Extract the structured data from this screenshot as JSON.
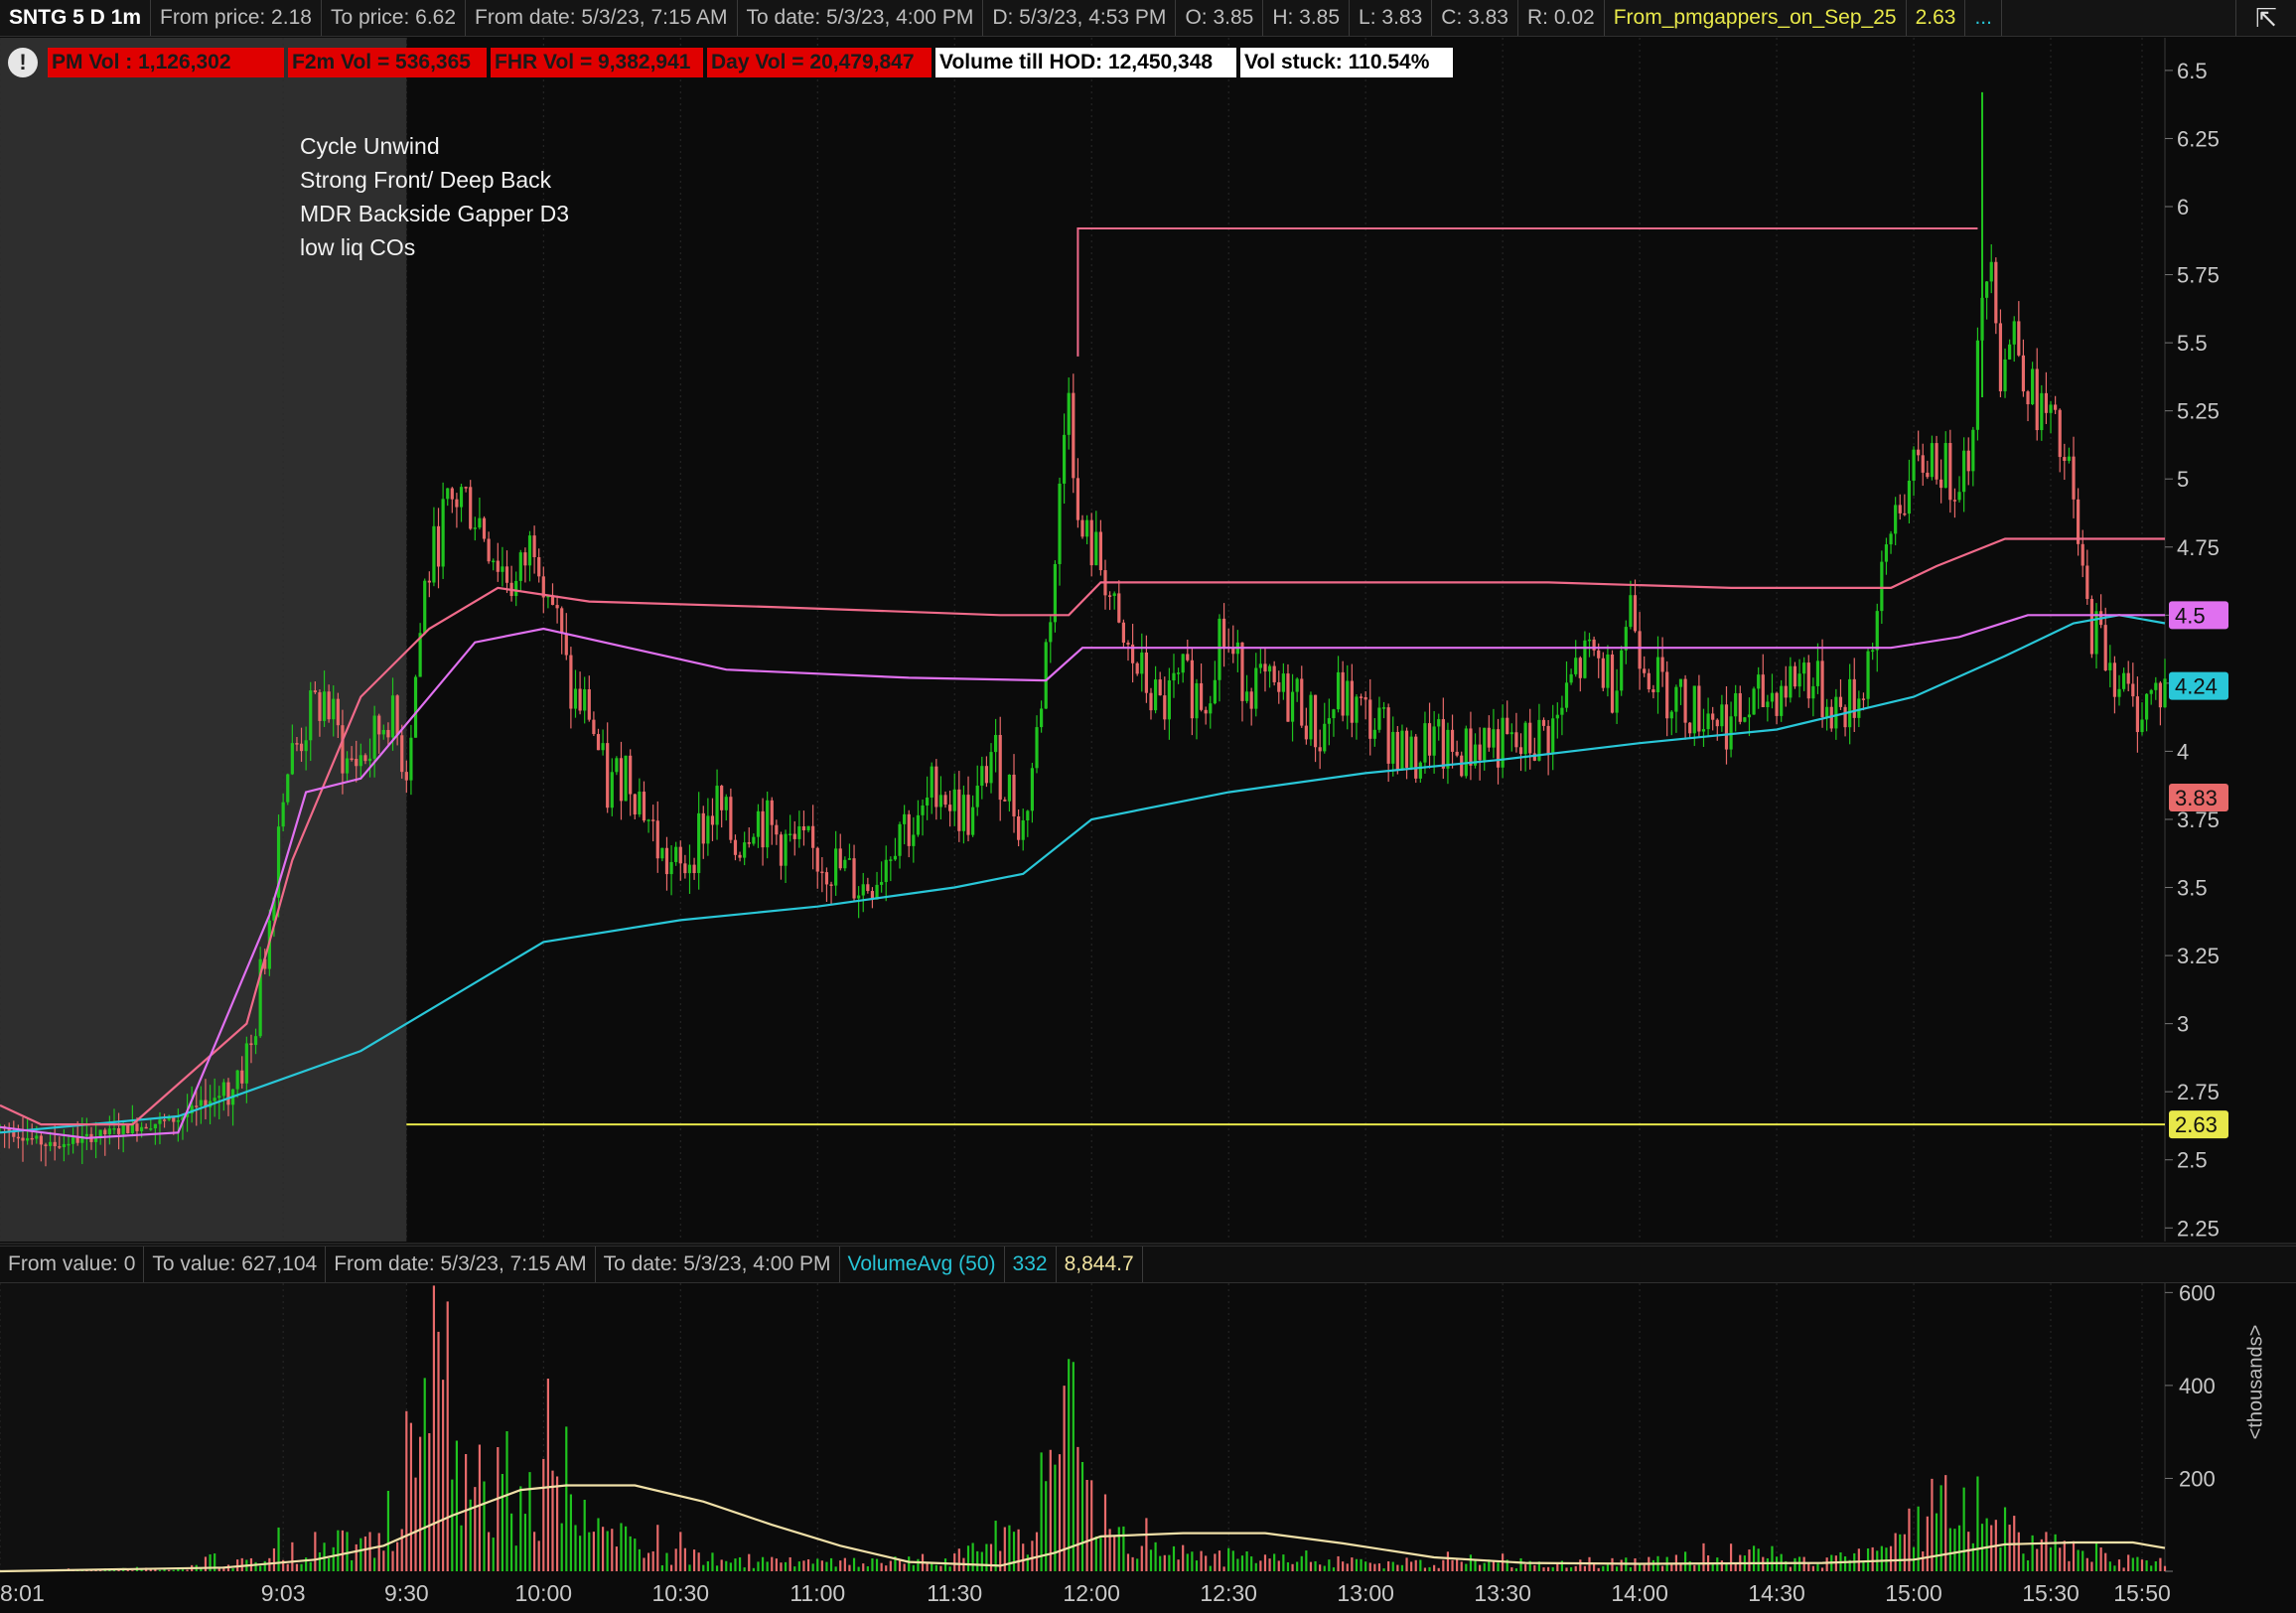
{
  "header": {
    "symbol": "SNTG 5 D 1m",
    "from_price": "From price: 2.18",
    "to_price": "To price: 6.62",
    "from_date": "From date: 5/3/23, 7:15 AM",
    "to_date": "To date: 5/3/23, 4:00 PM",
    "d": "D: 5/3/23, 4:53 PM",
    "o": "O: 3.85",
    "h": "H: 3.85",
    "l": "L: 3.83",
    "c": "C: 3.83",
    "r": "R: 0.02",
    "study_name": "From_pmgappers_on_Sep_25",
    "study_value": "2.63",
    "more": "...",
    "collapse_icon": "collapse-icon"
  },
  "stat_boxes": {
    "alert_icon": "!",
    "pm_vol": "PM Vol : 1,126,302",
    "f2m_vol": "F2m Vol = 536,365",
    "fhr_vol": "FHR Vol = 9,382,941",
    "day_vol": "Day Vol = 20,479,847",
    "vol_till_hod": "Volume till HOD: 12,450,348",
    "vol_stuck": "Vol stuck: 110.54%"
  },
  "notes": [
    "Cycle Unwind",
    "Strong Front/ Deep Back",
    "MDR Backside Gapper D3",
    "low liq COs"
  ],
  "volume_header": {
    "from_value": "From value: 0",
    "to_value": "To value: 627,104",
    "from_date": "From date: 5/3/23, 7:15 AM",
    "to_date": "To date: 5/3/23, 4:00 PM",
    "study": "VolumeAvg (50)",
    "v1": "332",
    "v2": "8,844.7"
  },
  "volume_unit_label": "<thousands>",
  "colors": {
    "up": "#1fc41f",
    "down": "#e86a6a",
    "vwap": "#29c7d8",
    "band_upper": "#f06a8a",
    "band_mid": "#e070f0",
    "level": "#e8e84a",
    "volavg": "#f0e0a8",
    "premarket_shade": "#2e2e2e"
  },
  "chart_data": [
    {
      "type": "candlestick",
      "title": "SNTG 5 D 1m",
      "y_range": [
        2.2,
        6.62
      ],
      "y_ticks": [
        2.25,
        2.5,
        2.75,
        3,
        3.25,
        3.5,
        3.75,
        4,
        4.25,
        4.5,
        4.75,
        5,
        5.25,
        5.5,
        5.75,
        6,
        6.25,
        6.5
      ],
      "y_tick_labels": [
        "2.25",
        "2.5",
        "2.75",
        "3",
        "3.25",
        "3.5",
        "3.75",
        "4",
        "4.25",
        "4.5",
        "4.75",
        "5",
        "5.25",
        "5.5",
        "5.75",
        "6",
        "6.25",
        "6.5"
      ],
      "x_range_min": [
        481,
        955
      ],
      "x_ticks_min": [
        481,
        543,
        570,
        600,
        630,
        660,
        690,
        720,
        750,
        780,
        810,
        840,
        870,
        900,
        930,
        950
      ],
      "x_tick_labels": [
        "8:01",
        "9:03",
        "9:30",
        "10:00",
        "10:30",
        "11:00",
        "11:30",
        "12:00",
        "12:30",
        "13:00",
        "13:30",
        "14:00",
        "14:30",
        "15:00",
        "15:30",
        "15:50"
      ],
      "premarket_end_min": 570,
      "price_path": [
        [
          481,
          2.62
        ],
        [
          492,
          2.55
        ],
        [
          500,
          2.58
        ],
        [
          510,
          2.62
        ],
        [
          520,
          2.65
        ],
        [
          530,
          2.75
        ],
        [
          536,
          2.9
        ],
        [
          540,
          3.4
        ],
        [
          543,
          3.9
        ],
        [
          548,
          4.1
        ],
        [
          552,
          4.2
        ],
        [
          557,
          3.95
        ],
        [
          562,
          4.0
        ],
        [
          566,
          4.15
        ],
        [
          570,
          3.95
        ],
        [
          574,
          4.6
        ],
        [
          578,
          4.85
        ],
        [
          582,
          4.95
        ],
        [
          586,
          4.85
        ],
        [
          590,
          4.7
        ],
        [
          594,
          4.6
        ],
        [
          598,
          4.8
        ],
        [
          602,
          4.55
        ],
        [
          606,
          4.2
        ],
        [
          610,
          4.15
        ],
        [
          614,
          3.85
        ],
        [
          618,
          3.95
        ],
        [
          622,
          3.8
        ],
        [
          626,
          3.6
        ],
        [
          630,
          3.55
        ],
        [
          634,
          3.7
        ],
        [
          638,
          3.8
        ],
        [
          642,
          3.65
        ],
        [
          646,
          3.78
        ],
        [
          650,
          3.7
        ],
        [
          654,
          3.65
        ],
        [
          658,
          3.62
        ],
        [
          662,
          3.6
        ],
        [
          666,
          3.55
        ],
        [
          670,
          3.5
        ],
        [
          674,
          3.58
        ],
        [
          678,
          3.75
        ],
        [
          682,
          3.7
        ],
        [
          686,
          3.9
        ],
        [
          690,
          3.8
        ],
        [
          694,
          3.75
        ],
        [
          698,
          4.0
        ],
        [
          702,
          3.85
        ],
        [
          705,
          3.72
        ],
        [
          708,
          4.05
        ],
        [
          712,
          4.7
        ],
        [
          715,
          5.4
        ],
        [
          717,
          4.8
        ],
        [
          720,
          4.75
        ],
        [
          723,
          4.65
        ],
        [
          726,
          4.4
        ],
        [
          730,
          4.3
        ],
        [
          735,
          4.15
        ],
        [
          740,
          4.25
        ],
        [
          745,
          4.2
        ],
        [
          748,
          4.45
        ],
        [
          752,
          4.3
        ],
        [
          756,
          4.25
        ],
        [
          760,
          4.2
        ],
        [
          765,
          4.2
        ],
        [
          770,
          4.05
        ],
        [
          774,
          4.2
        ],
        [
          778,
          4.15
        ],
        [
          782,
          4.1
        ],
        [
          786,
          4.05
        ],
        [
          790,
          3.95
        ],
        [
          794,
          4.05
        ],
        [
          798,
          3.98
        ],
        [
          802,
          4.0
        ],
        [
          806,
          4.05
        ],
        [
          810,
          4.02
        ],
        [
          814,
          4.0
        ],
        [
          818,
          4.05
        ],
        [
          822,
          4.1
        ],
        [
          826,
          4.3
        ],
        [
          830,
          4.35
        ],
        [
          834,
          4.25
        ],
        [
          838,
          4.55
        ],
        [
          840,
          4.4
        ],
        [
          844,
          4.25
        ],
        [
          848,
          4.2
        ],
        [
          852,
          4.15
        ],
        [
          856,
          4.15
        ],
        [
          860,
          4.1
        ],
        [
          864,
          4.15
        ],
        [
          868,
          4.2
        ],
        [
          872,
          4.25
        ],
        [
          876,
          4.3
        ],
        [
          880,
          4.2
        ],
        [
          884,
          4.15
        ],
        [
          888,
          4.2
        ],
        [
          892,
          4.5
        ],
        [
          896,
          4.9
        ],
        [
          900,
          5.0
        ],
        [
          904,
          5.1
        ],
        [
          908,
          5.0
        ],
        [
          912,
          5.1
        ],
        [
          915,
          5.6
        ],
        [
          917,
          5.9
        ],
        [
          919,
          5.4
        ],
        [
          922,
          5.55
        ],
        [
          926,
          5.3
        ],
        [
          930,
          5.2
        ],
        [
          934,
          5.0
        ],
        [
          938,
          4.5
        ],
        [
          941,
          4.4
        ],
        [
          944,
          4.3
        ],
        [
          948,
          4.15
        ],
        [
          952,
          4.2
        ],
        [
          955,
          4.24
        ]
      ],
      "series": [
        {
          "name": "VWAP",
          "values": [
            [
              481,
              2.6
            ],
            [
              520,
              2.66
            ],
            [
              560,
              2.9
            ],
            [
              600,
              3.3
            ],
            [
              630,
              3.38
            ],
            [
              660,
              3.43
            ],
            [
              690,
              3.5
            ],
            [
              705,
              3.55
            ],
            [
              720,
              3.75
            ],
            [
              750,
              3.85
            ],
            [
              780,
              3.92
            ],
            [
              810,
              3.97
            ],
            [
              840,
              4.03
            ],
            [
              870,
              4.08
            ],
            [
              900,
              4.2
            ],
            [
              920,
              4.35
            ],
            [
              935,
              4.47
            ],
            [
              945,
              4.5
            ],
            [
              955,
              4.47
            ]
          ]
        },
        {
          "name": "VWAP band upper",
          "values": [
            [
              481,
              2.7
            ],
            [
              490,
              2.63
            ],
            [
              510,
              2.63
            ],
            [
              535,
              3.0
            ],
            [
              545,
              3.6
            ],
            [
              560,
              4.2
            ],
            [
              575,
              4.45
            ],
            [
              590,
              4.6
            ],
            [
              610,
              4.55
            ],
            [
              650,
              4.53
            ],
            [
              700,
              4.5
            ],
            [
              715,
              4.5
            ],
            [
              722,
              4.62
            ],
            [
              760,
              4.62
            ],
            [
              820,
              4.62
            ],
            [
              860,
              4.6
            ],
            [
              895,
              4.6
            ],
            [
              905,
              4.68
            ],
            [
              920,
              4.78
            ],
            [
              955,
              4.78
            ]
          ]
        },
        {
          "name": "VWAP band mid",
          "values": [
            [
              481,
              2.62
            ],
            [
              500,
              2.58
            ],
            [
              520,
              2.6
            ],
            [
              540,
              3.4
            ],
            [
              548,
              3.85
            ],
            [
              560,
              3.9
            ],
            [
              575,
              4.2
            ],
            [
              585,
              4.4
            ],
            [
              600,
              4.45
            ],
            [
              640,
              4.3
            ],
            [
              680,
              4.27
            ],
            [
              710,
              4.26
            ],
            [
              718,
              4.38
            ],
            [
              760,
              4.38
            ],
            [
              820,
              4.38
            ],
            [
              860,
              4.38
            ],
            [
              895,
              4.38
            ],
            [
              910,
              4.42
            ],
            [
              925,
              4.5
            ],
            [
              955,
              4.5
            ]
          ]
        },
        {
          "name": "From_pmgappers_on_Sep_25",
          "values": [
            [
              570,
              2.63
            ],
            [
              955,
              2.63
            ]
          ]
        }
      ],
      "hod_marker": {
        "price": 5.92,
        "from_min": 717,
        "to_min": 914
      },
      "bubbles": [
        {
          "price": 4.5,
          "label": "4.5",
          "color": "#e070f0"
        },
        {
          "price": 4.24,
          "label": "4.24",
          "color": "#29c7d8"
        },
        {
          "price": 3.83,
          "label": "3.83",
          "color": "#e86a6a"
        },
        {
          "price": 2.63,
          "label": "2.63",
          "color": "#e8e84a"
        }
      ]
    },
    {
      "type": "bar",
      "title": "VolumeAvg (50)",
      "y_range": [
        0,
        620
      ],
      "y_ticks": [
        0,
        200,
        400,
        600
      ],
      "y_tick_labels": [
        "",
        "200",
        "400",
        "600"
      ],
      "ylabel": "<thousands>",
      "volume_profile": [
        [
          481,
          0
        ],
        [
          520,
          8
        ],
        [
          536,
          30
        ],
        [
          548,
          60
        ],
        [
          560,
          90
        ],
        [
          568,
          150
        ],
        [
          572,
          280
        ],
        [
          576,
          520
        ],
        [
          580,
          420
        ],
        [
          586,
          300
        ],
        [
          594,
          220
        ],
        [
          600,
          200
        ],
        [
          606,
          170
        ],
        [
          612,
          110
        ],
        [
          620,
          60
        ],
        [
          630,
          40
        ],
        [
          640,
          30
        ],
        [
          660,
          20
        ],
        [
          690,
          30
        ],
        [
          705,
          90
        ],
        [
          712,
          220
        ],
        [
          715,
          560
        ],
        [
          718,
          260
        ],
        [
          722,
          90
        ],
        [
          735,
          45
        ],
        [
          760,
          30
        ],
        [
          780,
          25
        ],
        [
          810,
          20
        ],
        [
          840,
          25
        ],
        [
          860,
          30
        ],
        [
          880,
          25
        ],
        [
          895,
          70
        ],
        [
          900,
          120
        ],
        [
          905,
          170
        ],
        [
          912,
          140
        ],
        [
          915,
          320
        ],
        [
          918,
          100
        ],
        [
          925,
          90
        ],
        [
          935,
          50
        ],
        [
          945,
          30
        ],
        [
          955,
          15
        ]
      ],
      "average": [
        [
          481,
          0
        ],
        [
          530,
          8
        ],
        [
          550,
          25
        ],
        [
          565,
          55
        ],
        [
          580,
          120
        ],
        [
          595,
          175
        ],
        [
          605,
          185
        ],
        [
          620,
          185
        ],
        [
          635,
          150
        ],
        [
          650,
          100
        ],
        [
          665,
          55
        ],
        [
          680,
          20
        ],
        [
          700,
          12
        ],
        [
          712,
          40
        ],
        [
          722,
          75
        ],
        [
          740,
          82
        ],
        [
          758,
          82
        ],
        [
          775,
          60
        ],
        [
          795,
          30
        ],
        [
          815,
          18
        ],
        [
          840,
          16
        ],
        [
          880,
          18
        ],
        [
          900,
          25
        ],
        [
          912,
          45
        ],
        [
          920,
          58
        ],
        [
          935,
          62
        ],
        [
          948,
          62
        ],
        [
          955,
          50
        ]
      ]
    }
  ]
}
